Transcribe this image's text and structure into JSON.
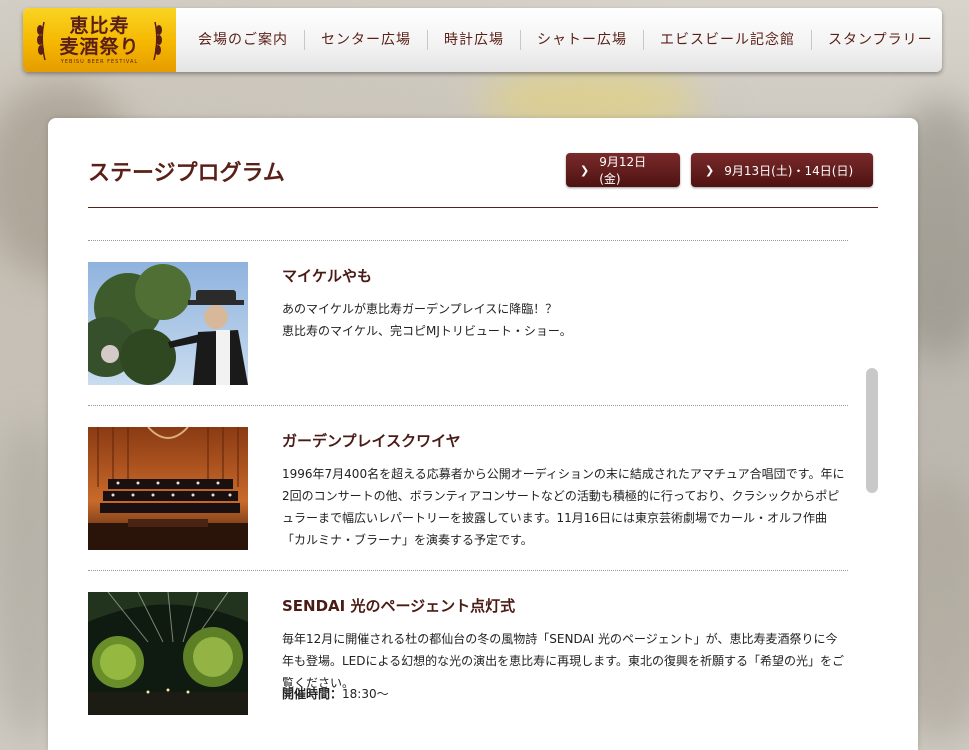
{
  "header": {
    "logo": {
      "line1": "恵比寿",
      "line2": "麦酒祭り",
      "sub": "YEBISU BEER FESTIVAL"
    },
    "nav": [
      {
        "label": "会場のご案内"
      },
      {
        "label": "センター広場"
      },
      {
        "label": "時計広場"
      },
      {
        "label": "シャトー広場"
      },
      {
        "label": "エビスビール記念館"
      },
      {
        "label": "スタンプラリー"
      }
    ]
  },
  "main": {
    "title": "ステージプログラム",
    "day_buttons": [
      {
        "label": "9月12日(金)"
      },
      {
        "label": "9月13日(土)・14日(日)"
      }
    ],
    "programs": [
      {
        "name": "マイケルやも",
        "desc_lines": [
          "あのマイケルが恵比寿ガーデンプレイスに降臨！？",
          "恵比寿のマイケル、完コピMJトリビュート・ショー。"
        ]
      },
      {
        "name": "ガーデンプレイスクワイヤ",
        "desc": "1996年7月400名を超える応募者から公開オーディションの末に結成されたアマチュア合唱団です。年に2回のコンサートの他、ボランティアコンサートなどの活動も積極的に行っており、クラシックからポピュラーまで幅広いレパートリーを披露しています。11月16日には東京芸術劇場でカール・オルフ作曲「カルミナ・ブラーナ」を演奏する予定です。"
      },
      {
        "name": "SENDAI 光のページェント点灯式",
        "desc": "毎年12月に開催される杜の都仙台の冬の風物詩「SENDAI 光のページェント」が、恵比寿麦酒祭りに今年も登場。LEDによる幻想的な光の演出を恵比寿に再現します。東北の復興を祈願する「希望の光」をご覧ください。",
        "time_label": "開催時間：",
        "time_value": "18:30〜"
      }
    ]
  },
  "colors": {
    "accent": "#5a1f17",
    "button": "#6a1f1f",
    "logo_gold": "#f5b700"
  }
}
